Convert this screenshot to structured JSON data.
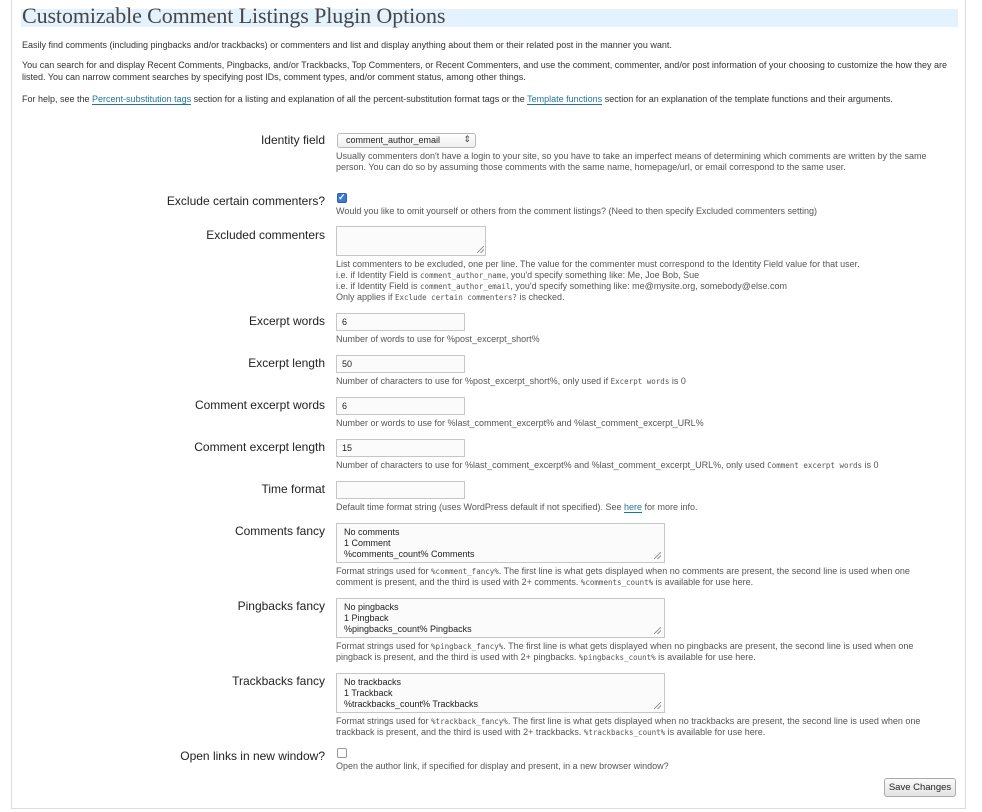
{
  "page_title": "Customizable Comment Listings Plugin Options",
  "intro": {
    "p1": "Easily find comments (including pingbacks and/or trackbacks) or commenters and list and display anything about them or their related post in the manner you want.",
    "p2": "You can search for and display Recent Comments, Pingbacks, and/or Trackbacks, Top Commenters, or Recent Commenters, and use the comment, commenter, and/or post information of your choosing to customize the how they are listed. You can narrow comment searches by specifying post IDs, comment types, and/or comment status, among other things.",
    "p3_before": "For help, see the ",
    "p3_link1": "Percent-substitution tags",
    "p3_middle": " section for a listing and explanation of all the percent-substitution format tags or the ",
    "p3_link2": "Template functions",
    "p3_after": " section for an explanation of the template functions and their arguments."
  },
  "fields": {
    "identity_field": {
      "label": "Identity field",
      "value": "comment_author_email",
      "help": "Usually commenters don't have a login to your site, so you have to take an imperfect means of determining which comments are written by the same person. You can do so by assuming those comments with the same name, homepage/url, or email correspond to the same user."
    },
    "exclude_commenters": {
      "label": "Exclude certain commenters?",
      "checked": true,
      "help": "Would you like to omit yourself or others from the comment listings? (Need to then specify Excluded commenters setting)"
    },
    "excluded_commenters": {
      "label": "Excluded commenters",
      "value": "",
      "help1": "List commenters to be excluded, one per line. The value for the commenter must correspond to the Identity Field value for that user.",
      "help2a": "i.e. if Identity Field is ",
      "help2code": "comment_author_name",
      "help2b": ", you'd specify something like: Me, Joe Bob, Sue",
      "help3a": "i.e. if Identity Field is ",
      "help3code": "comment_author_email",
      "help3b": ", you'd specify something like: me@mysite.org, somebody@else.com",
      "help4a": "Only applies if ",
      "help4code": "Exclude certain commenters?",
      "help4b": " is checked."
    },
    "excerpt_words": {
      "label": "Excerpt words",
      "value": "6",
      "help": "Number of words to use for %post_excerpt_short%"
    },
    "excerpt_length": {
      "label": "Excerpt length",
      "value": "50",
      "help_a": "Number of characters to use for %post_excerpt_short%, only used if ",
      "help_code": "Excerpt words",
      "help_b": " is 0"
    },
    "comment_excerpt_words": {
      "label": "Comment excerpt words",
      "value": "6",
      "help": "Number or words to use for %last_comment_excerpt% and %last_comment_excerpt_URL%"
    },
    "comment_excerpt_length": {
      "label": "Comment excerpt length",
      "value": "15",
      "help_a": "Number of characters to use for %last_comment_excerpt% and %last_comment_excerpt_URL%, only used ",
      "help_code": "Comment excerpt words",
      "help_b": " is 0"
    },
    "time_format": {
      "label": "Time format",
      "value": "",
      "help_a": "Default time format string (uses WordPress default if not specified). See ",
      "help_link": "here",
      "help_b": " for more info."
    },
    "comments_fancy": {
      "label": "Comments fancy",
      "value": "No comments\n1 Comment\n%comments_count% Comments",
      "help_a": "Format strings used for ",
      "help_code1": "%comment_fancy%",
      "help_b": ". The first line is what gets displayed when no comments are present, the second line is used when one comment is present, and the third is used with 2+ comments. ",
      "help_code2": "%comments_count%",
      "help_c": " is available for use here."
    },
    "pingbacks_fancy": {
      "label": "Pingbacks fancy",
      "value": "No pingbacks\n1 Pingback\n%pingbacks_count% Pingbacks",
      "help_a": "Format strings used for ",
      "help_code1": "%pingback_fancy%",
      "help_b": ". The first line is what gets displayed when no pingbacks are present, the second line is used when one pingback is present, and the third is used with 2+ pingbacks. ",
      "help_code2": "%pingbacks_count%",
      "help_c": " is available for use here."
    },
    "trackbacks_fancy": {
      "label": "Trackbacks fancy",
      "value": "No trackbacks\n1 Trackback\n%trackbacks_count% Trackbacks",
      "help_a": "Format strings used for ",
      "help_code1": "%trackback_fancy%",
      "help_b": ". The first line is what gets displayed when no trackbacks are present, the second line is used when one trackback is present, and the third is used with 2+ trackbacks. ",
      "help_code2": "%trackbacks_count%",
      "help_c": " is available for use here."
    },
    "open_links_new_window": {
      "label": "Open links in new window?",
      "checked": false,
      "help": "Open the author link, if specified for display and present, in a new browser window?"
    }
  },
  "save_button": "Save Changes",
  "colors": {
    "title_band": "#e4f2fd",
    "link": "#21759b",
    "checkbox_checked": "#3a78d6"
  }
}
